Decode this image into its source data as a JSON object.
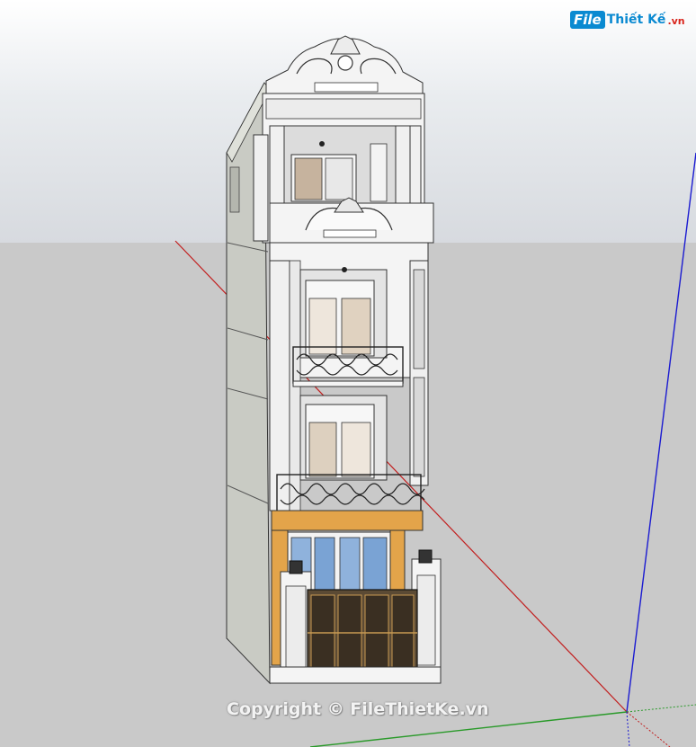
{
  "watermark": {
    "logo_mark": "File",
    "logo_name": "Thiết Kế",
    "logo_tld": ".vn",
    "copyright": "Copyright © FileThietKe.vn"
  },
  "colors": {
    "sky": "#e6e9ed",
    "ground": "#c9c9c9",
    "axis_red": "#c21e1e",
    "axis_green": "#2a9a2a",
    "axis_blue": "#1b1bd1",
    "facade": "#f4f4f4",
    "side_wall": "#c7c9c2",
    "wood": "#e3a44a",
    "glass": "#8fb2dc"
  },
  "icons": {
    "origin": "axes-origin-icon"
  }
}
